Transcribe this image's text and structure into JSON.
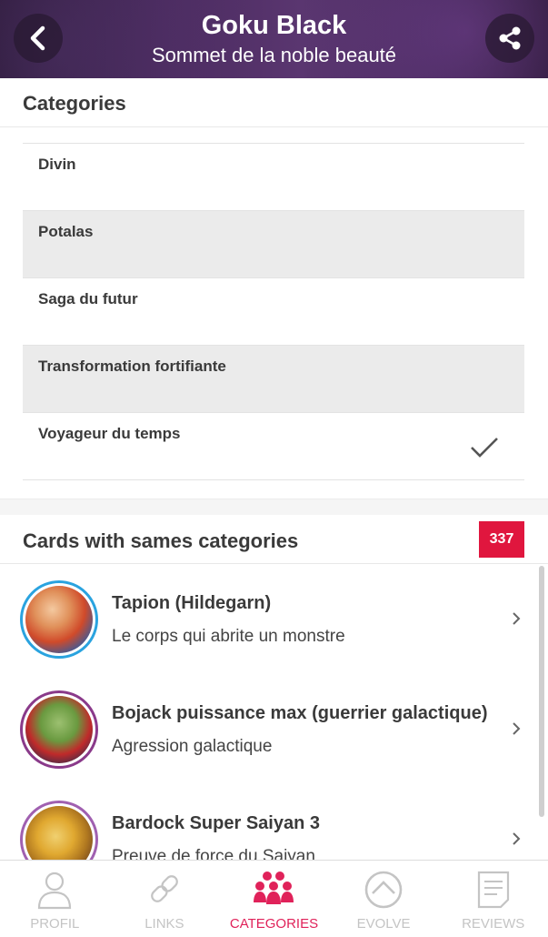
{
  "header": {
    "title": "Goku Black",
    "subtitle": "Sommet de la noble beauté"
  },
  "categories_section": {
    "title": "Categories",
    "items": [
      {
        "label": "Divin",
        "checked": false
      },
      {
        "label": "Potalas",
        "checked": false
      },
      {
        "label": "Saga du futur",
        "checked": false
      },
      {
        "label": "Transformation fortifiante",
        "checked": false
      },
      {
        "label": "Voyageur du temps",
        "checked": true
      }
    ]
  },
  "cards_section": {
    "title": "Cards with sames categories",
    "count": "337",
    "cards": [
      {
        "name": "Tapion (Hildegarn)",
        "subtitle": "Le corps qui abrite un monstre",
        "ring_color": "#2aa3df"
      },
      {
        "name": "Bojack puissance max (guerrier galactique)",
        "subtitle": "Agression galactique",
        "ring_color": "#8a3a8a"
      },
      {
        "name": "Bardock Super Saiyan 3",
        "subtitle": "Preuve de force du Saiyan",
        "ring_color": "#a060b0"
      }
    ]
  },
  "bottom_nav": {
    "items": [
      {
        "label": "PROFIL",
        "icon": "person-icon",
        "active": false
      },
      {
        "label": "LINKS",
        "icon": "link-icon",
        "active": false
      },
      {
        "label": "CATEGORIES",
        "icon": "group-icon",
        "active": true
      },
      {
        "label": "EVOLVE",
        "icon": "evolve-icon",
        "active": false
      },
      {
        "label": "REVIEWS",
        "icon": "document-icon",
        "active": false
      }
    ]
  },
  "colors": {
    "accent": "#e0163e",
    "active_nav": "#e0225a",
    "inactive_nav": "#c4c4c4"
  }
}
